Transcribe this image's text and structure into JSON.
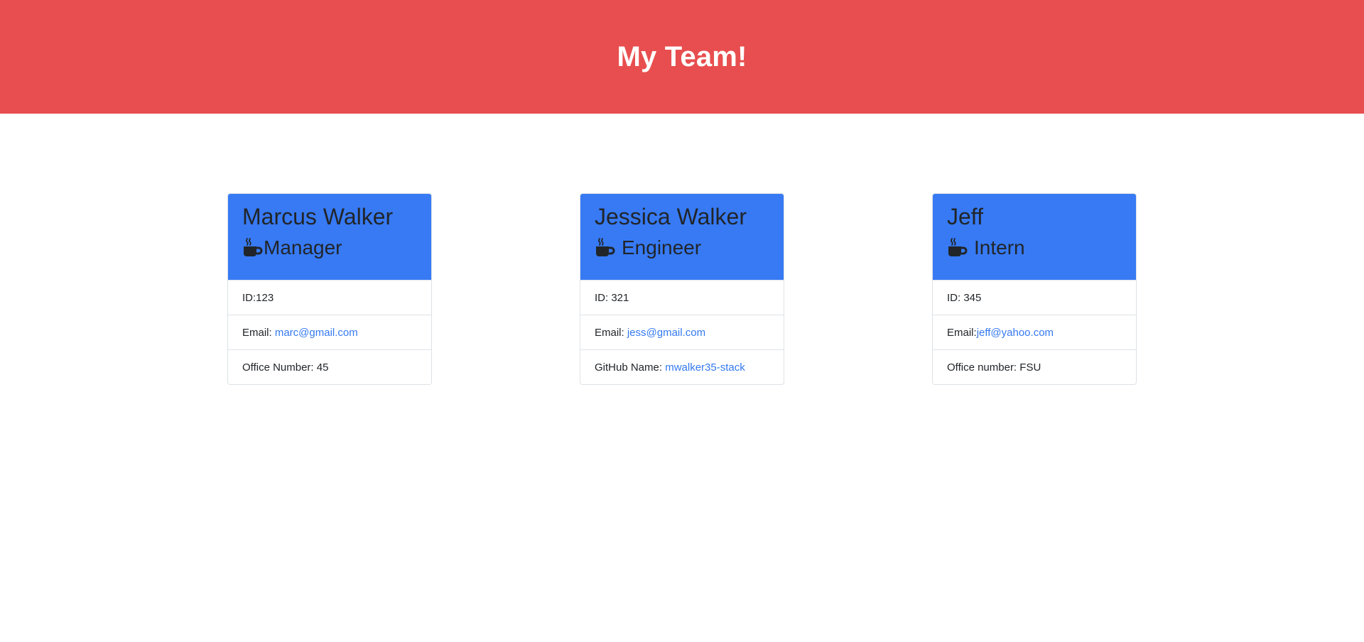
{
  "header": {
    "title": "My Team!"
  },
  "colors": {
    "header_bg": "#e84e4f",
    "card_header_bg": "#377af4",
    "link": "#3479f0"
  },
  "team": [
    {
      "name": "Marcus Walker",
      "role": "Manager",
      "icon": "coffee-mug-icon",
      "id_label": "ID: ",
      "id": "123",
      "email_label": "Email: ",
      "email": "marc@gmail.com",
      "extra_label": "Office Number: ",
      "extra_value": "45"
    },
    {
      "name": "Jessica Walker",
      "role": "Engineer",
      "icon": "coffee-mug-icon",
      "id_label": "ID: ",
      "id": "321",
      "email_label": "Email: ",
      "email": "jess@gmail.com",
      "extra_label": "GitHub Name: ",
      "extra_value": "mwalker35-stack"
    },
    {
      "name": "Jeff",
      "role": "Intern",
      "icon": "coffee-mug-icon",
      "id_label": "ID: ",
      "id": "345",
      "email_label": "Email:",
      "email": "jeff@yahoo.com",
      "extra_label": "Office number: ",
      "extra_value": "FSU"
    }
  ]
}
